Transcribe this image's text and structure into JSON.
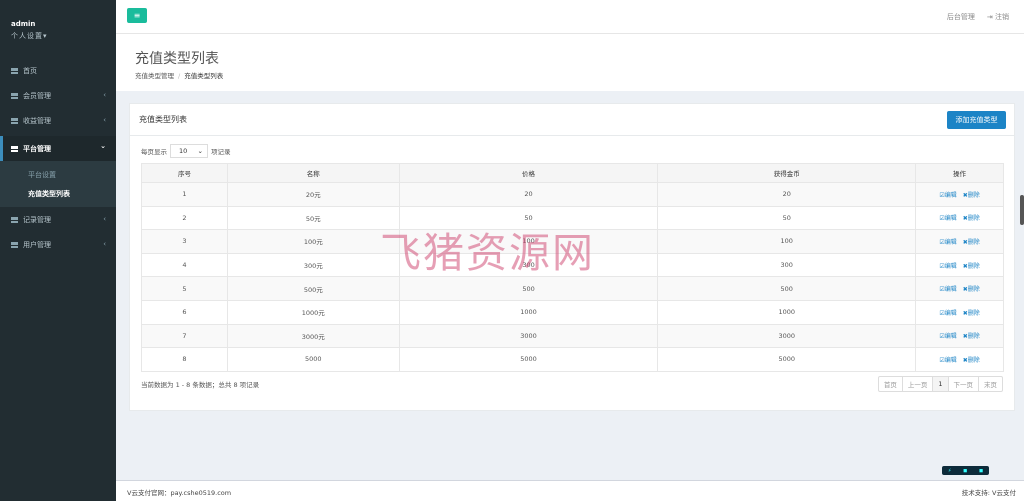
{
  "sidebar": {
    "user_name": "admin",
    "user_settings": "个人设置▾",
    "menu": [
      {
        "label": "首页",
        "icon": "list-icon",
        "arrow": ""
      },
      {
        "label": "会员管理",
        "icon": "list-icon",
        "arrow": "‹"
      },
      {
        "label": "收益管理",
        "icon": "list-icon",
        "arrow": "‹"
      },
      {
        "label": "平台管理",
        "icon": "list-icon",
        "arrow": "⌄"
      },
      {
        "label": "记录管理",
        "icon": "list-icon",
        "arrow": "‹"
      },
      {
        "label": "用户管理",
        "icon": "list-icon",
        "arrow": "‹"
      }
    ],
    "submenu": [
      {
        "label": "平台设置"
      },
      {
        "label": "充值类型列表"
      }
    ]
  },
  "header": {
    "toggle_icon": "≡",
    "backend_label": "后台管理",
    "logout_label": "注销",
    "logout_icon": "⇥"
  },
  "page": {
    "title": "充值类型列表",
    "breadcrumb": [
      "充值类型管理",
      "/",
      "充值类型列表"
    ]
  },
  "panel": {
    "title": "充值类型列表",
    "add_button": "添加充值类型",
    "length_prefix": "每页显示",
    "length_value": "10",
    "length_suffix": "项记录",
    "columns": [
      "序号",
      "名称",
      "价格",
      "获得金币",
      "操作"
    ],
    "rows": [
      {
        "id": "1",
        "name": "20元",
        "price": "20",
        "coins": "20"
      },
      {
        "id": "2",
        "name": "50元",
        "price": "50",
        "coins": "50"
      },
      {
        "id": "3",
        "name": "100元",
        "price": "100",
        "coins": "100"
      },
      {
        "id": "4",
        "name": "300元",
        "price": "300",
        "coins": "300"
      },
      {
        "id": "5",
        "name": "500元",
        "price": "500",
        "coins": "500"
      },
      {
        "id": "6",
        "name": "1000元",
        "price": "1000",
        "coins": "1000"
      },
      {
        "id": "7",
        "name": "3000元",
        "price": "3000",
        "coins": "3000"
      },
      {
        "id": "8",
        "name": "5000",
        "price": "5000",
        "coins": "5000"
      }
    ],
    "edit_label": "☑编辑",
    "delete_label": "✖删除",
    "info": "当前数据为 1 - 8 条数据；总共 8 项记录",
    "pager": [
      "首页",
      "上一页",
      "1",
      "下一页",
      "末页"
    ]
  },
  "footer": {
    "left": "V云支付官网：pay.cshe0519.com",
    "right": "技术支持: V云支付"
  },
  "watermark": "飞猪资源网",
  "colors": {
    "sidebar": "#222d32",
    "accent": "#1c84c6",
    "toggle": "#1abc9c"
  }
}
